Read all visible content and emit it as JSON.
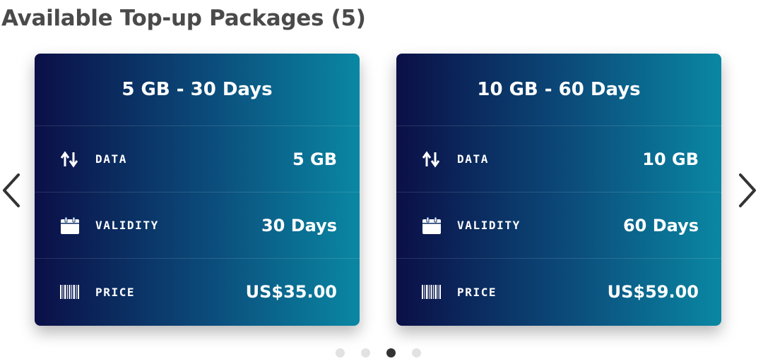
{
  "section": {
    "title": "Available Top-up Packages (5)"
  },
  "labels": {
    "data": "DATA",
    "validity": "VALIDITY",
    "price": "PRICE"
  },
  "packages": [
    {
      "title": "5 GB - 30 Days",
      "data": "5 GB",
      "validity": "30 Days",
      "price": "US$35.00"
    },
    {
      "title": "10 GB - 60 Days",
      "data": "10 GB",
      "validity": "60 Days",
      "price": "US$59.00"
    }
  ],
  "icons": {
    "prev": "chevron-left-icon",
    "next": "chevron-right-icon",
    "data": "data-transfer-icon",
    "validity": "calendar-icon",
    "price": "barcode-icon"
  },
  "carousel": {
    "page_count": 4,
    "active_page": 3
  },
  "colors": {
    "heading": "#4a4a4a",
    "card_gradient_start": "#0b0f47",
    "card_gradient_end": "#0a87a3",
    "dot_active": "#333333",
    "dot_inactive": "#e2e2e2"
  }
}
